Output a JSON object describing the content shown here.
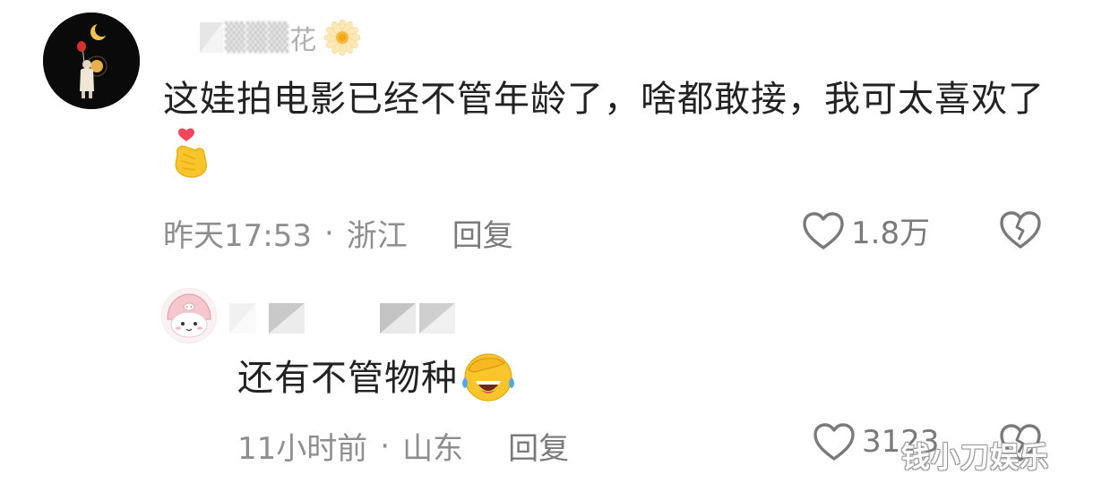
{
  "main_comment": {
    "username_visible": "花",
    "text": "这娃拍电影已经不管年龄了，啥都敢接，我可太喜欢了",
    "emoji_icon": "finger-heart-icon",
    "name_emoji_icon": "daisy-flower-icon",
    "time": "昨天17:53",
    "separator": "·",
    "location": "浙江",
    "reply_label": "回复",
    "likes": "1.8万"
  },
  "reply_comment": {
    "text": "还有不管物种",
    "emoji_icon": "rolling-laughing-face-icon",
    "time": "11小时前",
    "separator": "·",
    "location": "山东",
    "reply_label": "回复",
    "likes": "3123"
  },
  "watermark": "钱小刀娱乐",
  "colors": {
    "text_primary": "#222222",
    "text_meta": "#8e8e8e",
    "icon_gray": "#7a7a7a",
    "background": "#ffffff"
  }
}
